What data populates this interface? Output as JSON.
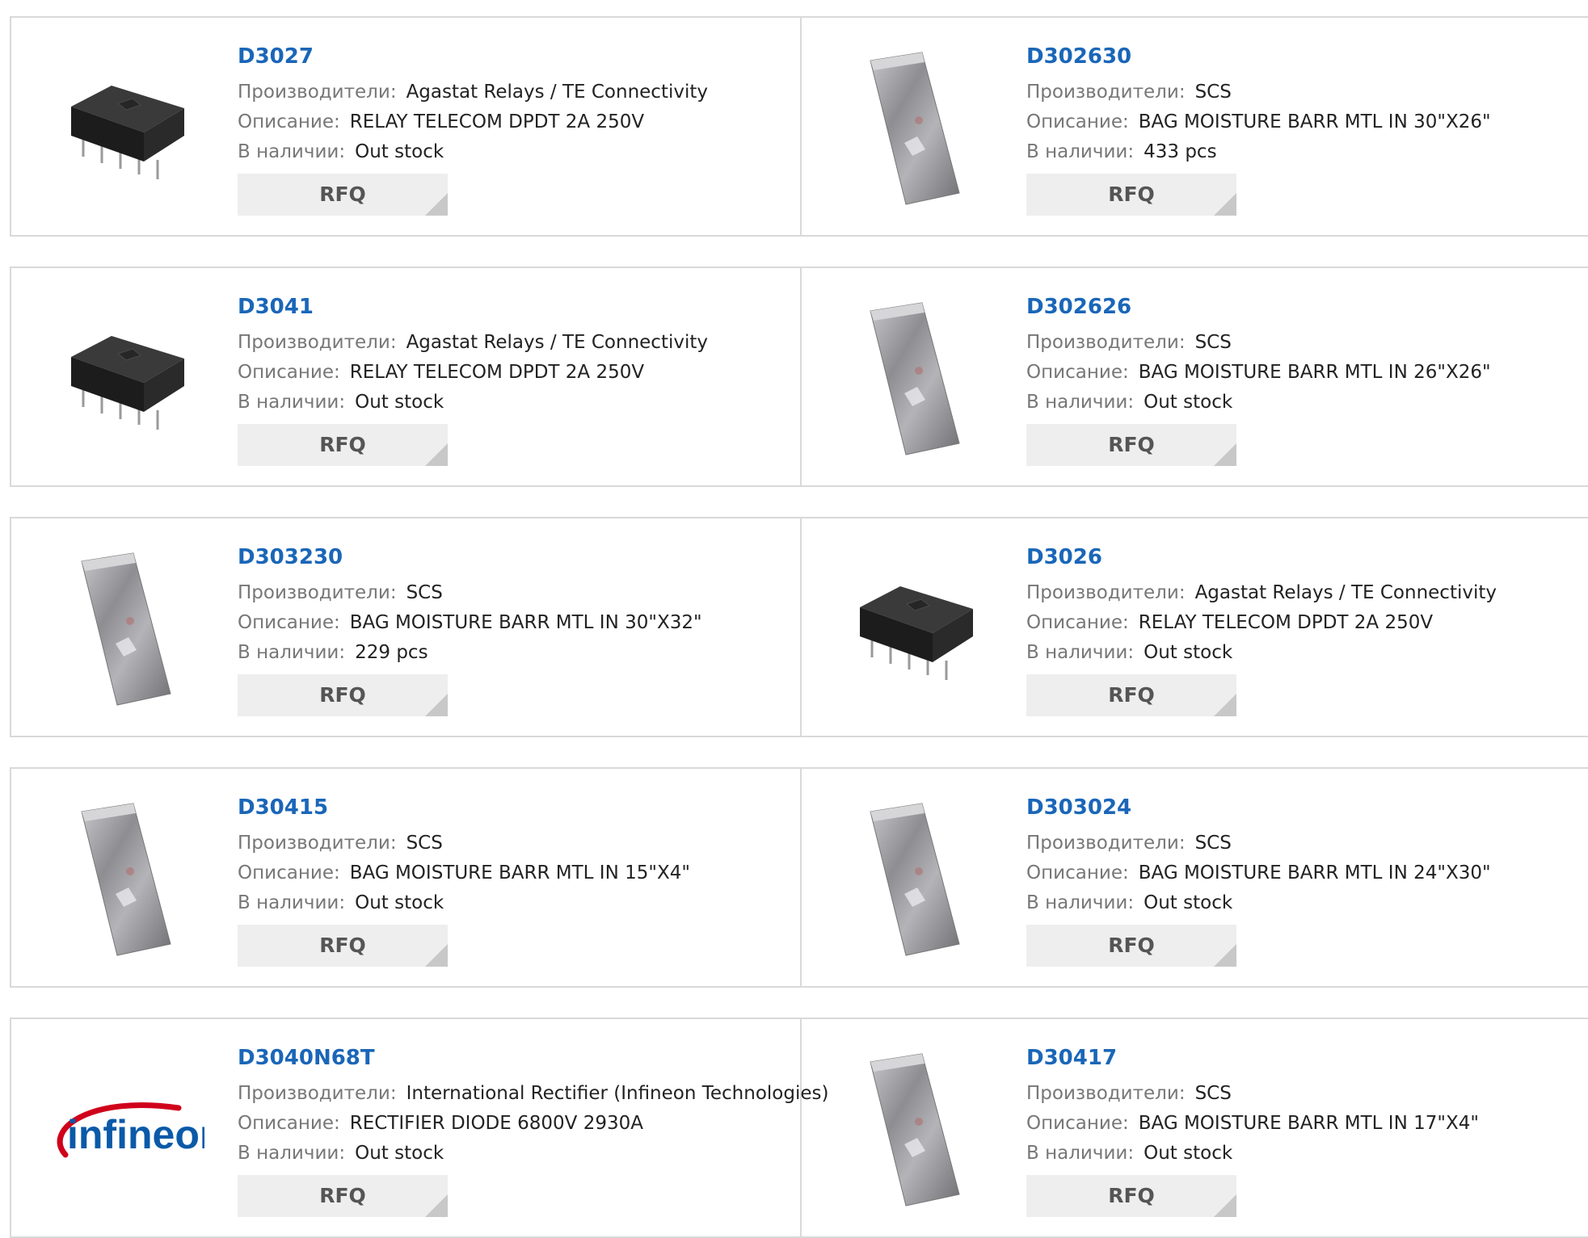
{
  "labels": {
    "manufacturer": "Производители:",
    "description": "Описание:",
    "stock": "В наличии:",
    "rfq": "RFQ"
  },
  "brand_colors": {
    "link": "#1a66b8",
    "infineon_red": "#d0021b",
    "infineon_blue": "#0a5aa8"
  },
  "rows": [
    [
      {
        "part": "D3027",
        "manufacturer": "Agastat Relays / TE Connectivity",
        "description": "RELAY TELECOM DPDT 2A 250V",
        "stock": "Out stock",
        "image": "relay"
      },
      {
        "part": "D302630",
        "manufacturer": "SCS",
        "description": "BAG MOISTURE BARR MTL IN 30\"X26\"",
        "stock": "433 pcs",
        "image": "bag"
      }
    ],
    [
      {
        "part": "D3041",
        "manufacturer": "Agastat Relays / TE Connectivity",
        "description": "RELAY TELECOM DPDT 2A 250V",
        "stock": "Out stock",
        "image": "relay"
      },
      {
        "part": "D302626",
        "manufacturer": "SCS",
        "description": "BAG MOISTURE BARR MTL IN 26\"X26\"",
        "stock": "Out stock",
        "image": "bag"
      }
    ],
    [
      {
        "part": "D303230",
        "manufacturer": "SCS",
        "description": "BAG MOISTURE BARR MTL IN 30\"X32\"",
        "stock": "229 pcs",
        "image": "bag"
      },
      {
        "part": "D3026",
        "manufacturer": "Agastat Relays / TE Connectivity",
        "description": "RELAY TELECOM DPDT 2A 250V",
        "stock": "Out stock",
        "image": "relay"
      }
    ],
    [
      {
        "part": "D30415",
        "manufacturer": "SCS",
        "description": "BAG MOISTURE BARR MTL IN 15\"X4\"",
        "stock": "Out stock",
        "image": "bag"
      },
      {
        "part": "D303024",
        "manufacturer": "SCS",
        "description": "BAG MOISTURE BARR MTL IN 24\"X30\"",
        "stock": "Out stock",
        "image": "bag"
      }
    ],
    [
      {
        "part": "D3040N68T",
        "manufacturer": "International Rectifier (Infineon Technologies)",
        "description": "RECTIFIER DIODE 6800V 2930A",
        "stock": "Out stock",
        "image": "infineon",
        "logo_text": "infineon"
      },
      {
        "part": "D30417",
        "manufacturer": "SCS",
        "description": "BAG MOISTURE BARR MTL IN 17\"X4\"",
        "stock": "Out stock",
        "image": "bag"
      }
    ]
  ]
}
